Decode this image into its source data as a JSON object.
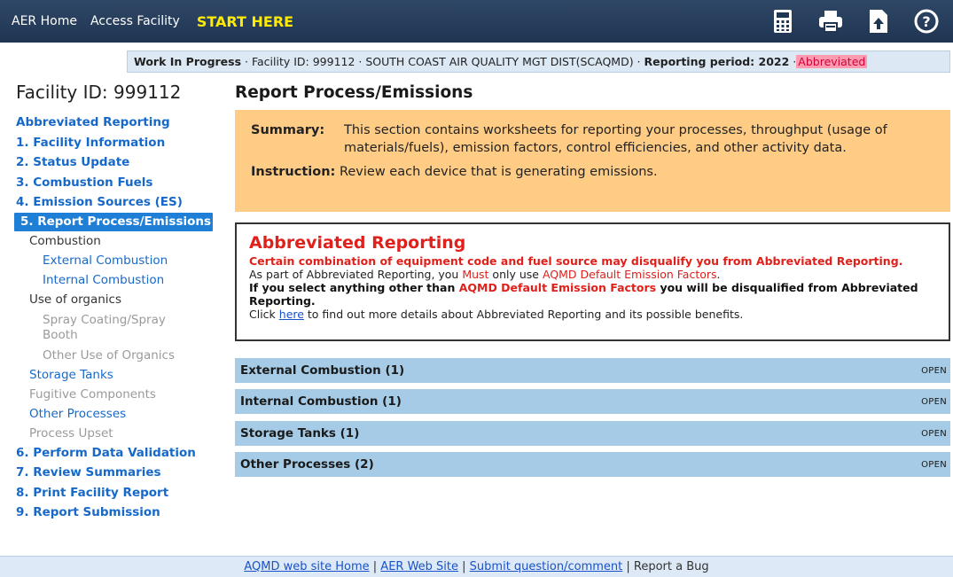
{
  "topbar": {
    "nav": [
      "AER Home",
      "Access Facility"
    ],
    "start": "START HERE",
    "icons": [
      "calculator-icon",
      "printer-icon",
      "upload-icon",
      "help-icon"
    ]
  },
  "status": {
    "wip": "Work In Progress",
    "facility": " · Facility ID: 999112 · SOUTH COAST AIR QUALITY MGT DIST(SCAQMD) · ",
    "period": "Reporting period: 2022",
    "sep": " ·",
    "abbreviated": "Abbreviated"
  },
  "sidebar": {
    "title": "Facility ID: 999112",
    "items": {
      "abbr": "Abbreviated Reporting",
      "s1": "1. Facility Information",
      "s2": "2. Status Update",
      "s3": "3. Combustion Fuels",
      "s4": "4. Emission Sources (ES)",
      "s5": "5. Report Process/Emissions",
      "combustion": "Combustion",
      "ext": "External Combustion",
      "int": "Internal Combustion",
      "organics": "Use of organics",
      "spray": "Spray Coating/Spray Booth",
      "otherOrg": "Other Use of Organics",
      "storage": "Storage Tanks",
      "fugitive": "Fugitive Components",
      "otherProc": "Other Processes",
      "upset": "Process Upset",
      "s6": "6. Perform Data Validation",
      "s7": "7. Review Summaries",
      "s8": "8. Print Facility Report",
      "s9": "9. Report Submission"
    }
  },
  "main": {
    "title": "Report Process/Emissions",
    "summary_label": "Summary:",
    "summary_text": "This section contains worksheets for reporting your processes, throughput (usage of materials/fuels), emission factors, control efficiencies, and other activity data.",
    "instruction_label": "Instruction:",
    "instruction_text": " Review each device that is generating emissions."
  },
  "abbr": {
    "heading": "Abbreviated Reporting",
    "line1": "Certain combination of equipment code and fuel source may disqualify you from Abbreviated Reporting.",
    "line2a": "As part of Abbreviated Reporting, you ",
    "line2b": "Must",
    "line2c": " only use ",
    "line2d": "AQMD Default Emission Factors",
    "line2e": ".",
    "line3a": "If you select anything other than ",
    "line3b": "AQMD Default Emission Factors",
    "line3c": " you will be disqualified from Abbreviated Reporting.",
    "line4a": "Click ",
    "line4link": "here",
    "line4b": " to find out more details about Abbreviated Reporting and its possible benefits."
  },
  "sections": [
    {
      "label": "External Combustion (1)",
      "action": "OPEN"
    },
    {
      "label": "Internal Combustion (1)",
      "action": "OPEN"
    },
    {
      "label": "Storage Tanks (1)",
      "action": "OPEN"
    },
    {
      "label": "Other Processes (2)",
      "action": "OPEN"
    }
  ],
  "footer": {
    "link1": "AQMD web site Home",
    "link2": "AER Web Site",
    "link3": "Submit question/comment",
    "link4": "Report a Bug",
    "sep": " | "
  }
}
